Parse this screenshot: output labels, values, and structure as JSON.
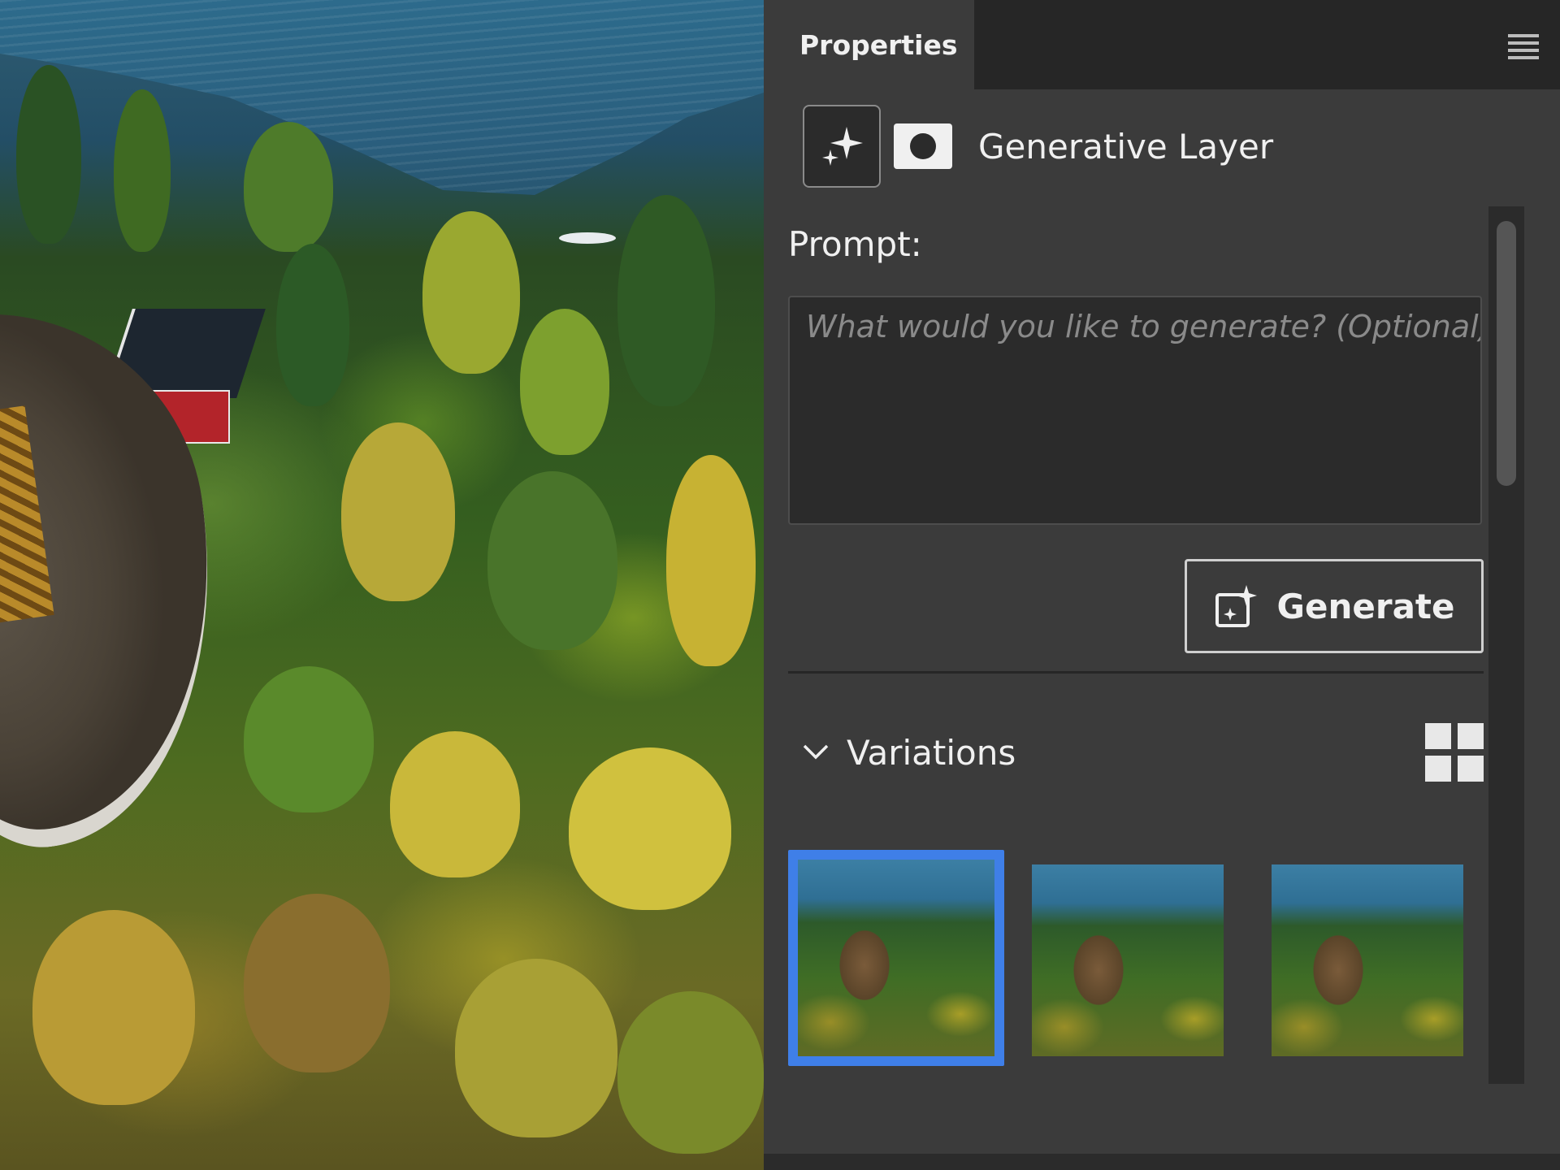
{
  "canvas": {
    "image_description_icon": "canvas-photo"
  },
  "panel": {
    "tab_label": "Properties",
    "menu_icon": "hamburger-menu-icon",
    "layer": {
      "title": "Generative Layer",
      "type_icon": "sparkle-icon",
      "mask_icon": "layer-mask-icon"
    },
    "prompt": {
      "label": "Prompt:",
      "placeholder": "What would you like to generate? (Optional)",
      "value": ""
    },
    "generate_button": {
      "label": "Generate",
      "icon": "generate-sparkle-icon"
    },
    "variations": {
      "title": "Variations",
      "chevron_icon": "chevron-down-icon",
      "grid_icon": "grid-view-icon",
      "items": [
        {
          "selected": true
        },
        {
          "selected": false
        },
        {
          "selected": false
        }
      ]
    }
  },
  "colors": {
    "panel_bg": "#3b3b3b",
    "tabbar_bg": "#262626",
    "input_bg": "#2b2b2b",
    "selection_accent": "#3f7fe8",
    "text": "#f0f0f0",
    "placeholder_text": "#8a8a8a"
  }
}
